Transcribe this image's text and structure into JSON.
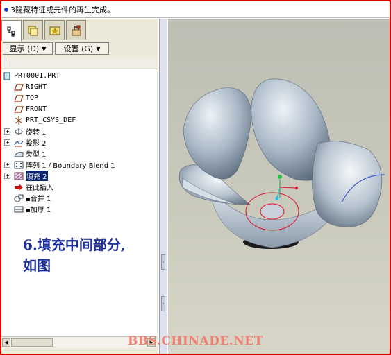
{
  "message_bar": {
    "text": "3隐藏特征或元件的再生完成。"
  },
  "tabs": [
    {
      "icon": "model-tree-icon"
    },
    {
      "icon": "folder-browser-icon"
    },
    {
      "icon": "favorites-icon"
    },
    {
      "icon": "connections-icon"
    }
  ],
  "toolbar": {
    "show_label": "显示 (D)",
    "settings_label": "设置 (G)"
  },
  "tree": {
    "items": [
      {
        "label": "PRT0001.PRT",
        "icon": "part-icon"
      },
      {
        "label": "RIGHT",
        "icon": "datum-plane-icon"
      },
      {
        "label": "TOP",
        "icon": "datum-plane-icon"
      },
      {
        "label": "FRONT",
        "icon": "datum-plane-icon"
      },
      {
        "label": "PRT_CSYS_DEF",
        "icon": "csys-icon"
      },
      {
        "label": "旋转 1",
        "icon": "revolve-icon"
      },
      {
        "label": "投影 2",
        "icon": "projected-curve-icon"
      },
      {
        "label": "类型 1",
        "icon": "surface-icon"
      },
      {
        "label": "阵列 1 / Boundary Blend 1",
        "icon": "pattern-icon"
      },
      {
        "label": "填充 2",
        "icon": "fill-icon"
      },
      {
        "label": "在此插入",
        "icon": "insert-here-icon"
      },
      {
        "label": "▪合并 1",
        "icon": "merge-icon"
      },
      {
        "label": "▪加厚 1",
        "icon": "thicken-icon"
      }
    ]
  },
  "annotation": {
    "line1": "6.填充中间部分,",
    "line2": "如图"
  },
  "watermark": "BBS.CHINADE.NET",
  "colors": {
    "frame": "#e00000",
    "annotation": "#1d2f9c",
    "selection": "#0a246a",
    "sketch": "#e0102a",
    "watermark": "#f08070"
  }
}
